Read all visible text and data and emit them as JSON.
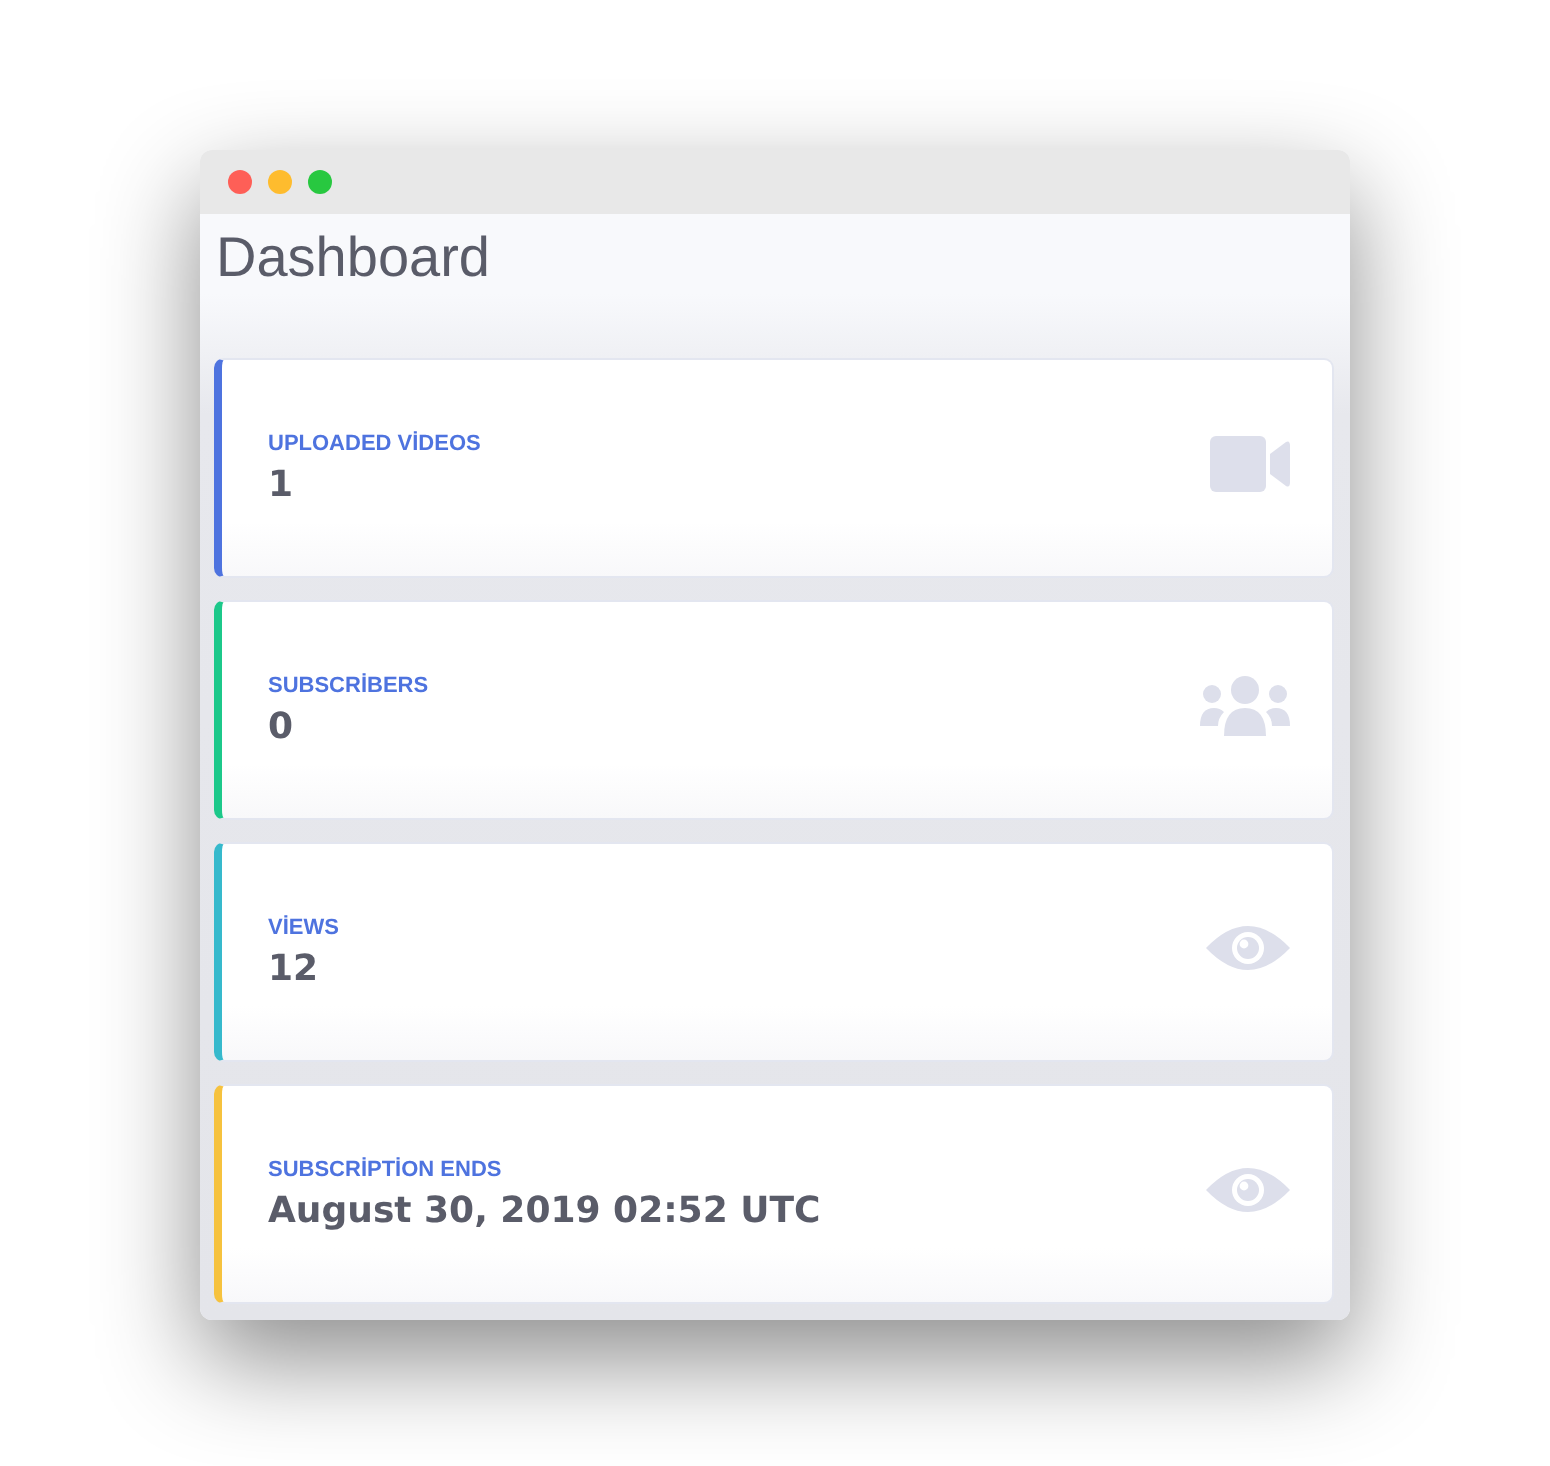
{
  "window": {
    "title_buttons": [
      {
        "kind": "close"
      },
      {
        "kind": "minimize"
      },
      {
        "kind": "maximize"
      }
    ]
  },
  "page": {
    "title": "Dashboard"
  },
  "cards": [
    {
      "label": "UPLOADED VİDEOS",
      "value": "1",
      "color": "#4e73df",
      "kind": "video"
    },
    {
      "label": "SUBSCRİBERS",
      "value": "0",
      "color": "#1cc88a",
      "kind": "users"
    },
    {
      "label": "VİEWS",
      "value": "12",
      "color": "#36b9cc",
      "kind": "eye"
    },
    {
      "label": "SUBSCRİPTİON ENDS",
      "value": "August 30, 2019 02:52 UTC",
      "color": "#f6c23e",
      "kind": "eye"
    }
  ]
}
